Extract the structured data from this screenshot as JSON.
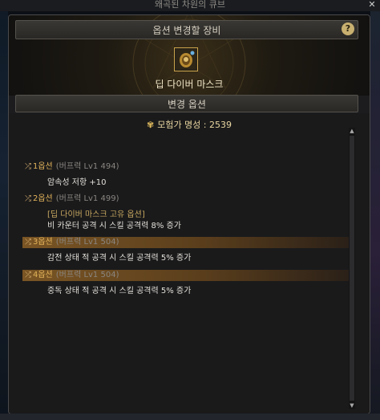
{
  "window": {
    "title": "왜곡된 차원의 큐브",
    "close_symbol": "✕"
  },
  "equipment": {
    "header": "옵션 변경할 장비",
    "help_symbol": "?",
    "item_name": "딥 다이버 마스크"
  },
  "change": {
    "header": "변경 옵션"
  },
  "fame": {
    "label": "모험가 명성 : 2539"
  },
  "options": [
    {
      "num": "1옵션",
      "tier": "(버프력 Lv1 494)",
      "lines": [
        "암속성 저항 +10"
      ],
      "highlighted": false
    },
    {
      "num": "2옵션",
      "tier": "(버프력 Lv1 499)",
      "lines": [
        "[딥 다이버 마스크 고유 옵션]",
        "비 카운터 공격 시 스킬 공격력 8% 증가"
      ],
      "highlighted": false
    },
    {
      "num": "3옵션",
      "tier": "(버프력 Lv1 504)",
      "lines": [
        "감전 상태 적 공격 시 스킬 공격력 5% 증가"
      ],
      "highlighted": true
    },
    {
      "num": "4옵션",
      "tier": "(버프력 Lv1 504)",
      "lines": [
        "중독 상태 적 공격 시 스킬 공격력 5% 증가"
      ],
      "highlighted": true
    }
  ],
  "colors": {
    "accent_gold": "#e0b25a",
    "highlight_row": "#7a5524",
    "window_bg": "#1c1c1e"
  }
}
